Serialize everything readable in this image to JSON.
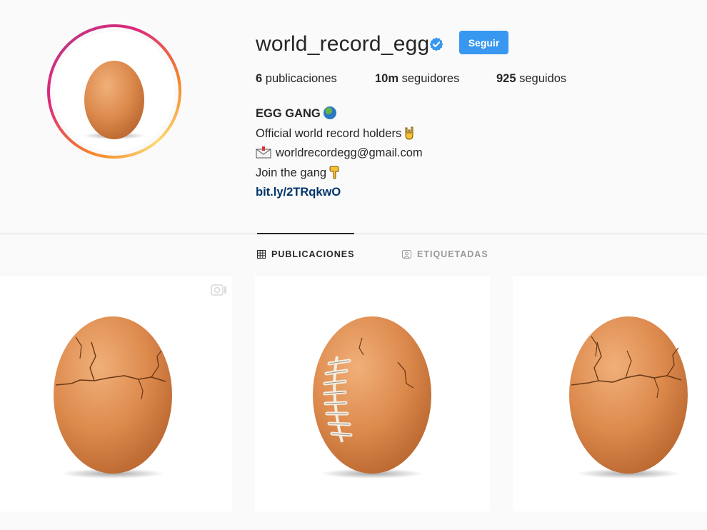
{
  "profile": {
    "username": "world_record_egg",
    "follow_label": "Seguir",
    "stats": {
      "posts_count": "6",
      "posts_label": "publicaciones",
      "followers_count": "10m",
      "followers_label": "seguidores",
      "following_count": "925",
      "following_label": "seguidos"
    },
    "bio": {
      "name": "EGG GANG",
      "line1": "Official world record holders",
      "email": "worldrecordegg@gmail.com",
      "line3": "Join the gang",
      "link": "bit.ly/2TRqkwO"
    }
  },
  "tabs": {
    "posts": "PUBLICACIONES",
    "tagged": "ETIQUETADAS"
  },
  "icons": {
    "verified": "verified-badge-icon",
    "globe": "globe-emoji-icon",
    "hand": "rock-hand-emoji-icon",
    "mail": "envelope-emoji-icon",
    "point": "pointing-down-emoji-icon",
    "grid": "grid-icon",
    "tagged": "tagged-user-icon",
    "multi": "multiple-photos-icon"
  },
  "posts": [
    {
      "variant": "cracked",
      "multiple": true
    },
    {
      "variant": "football",
      "multiple": false
    },
    {
      "variant": "cracked-more",
      "multiple": false
    }
  ],
  "colors": {
    "follow_button": "#3897f0",
    "link": "#003569",
    "verified": "#3897f0",
    "egg": "#d9894f"
  }
}
